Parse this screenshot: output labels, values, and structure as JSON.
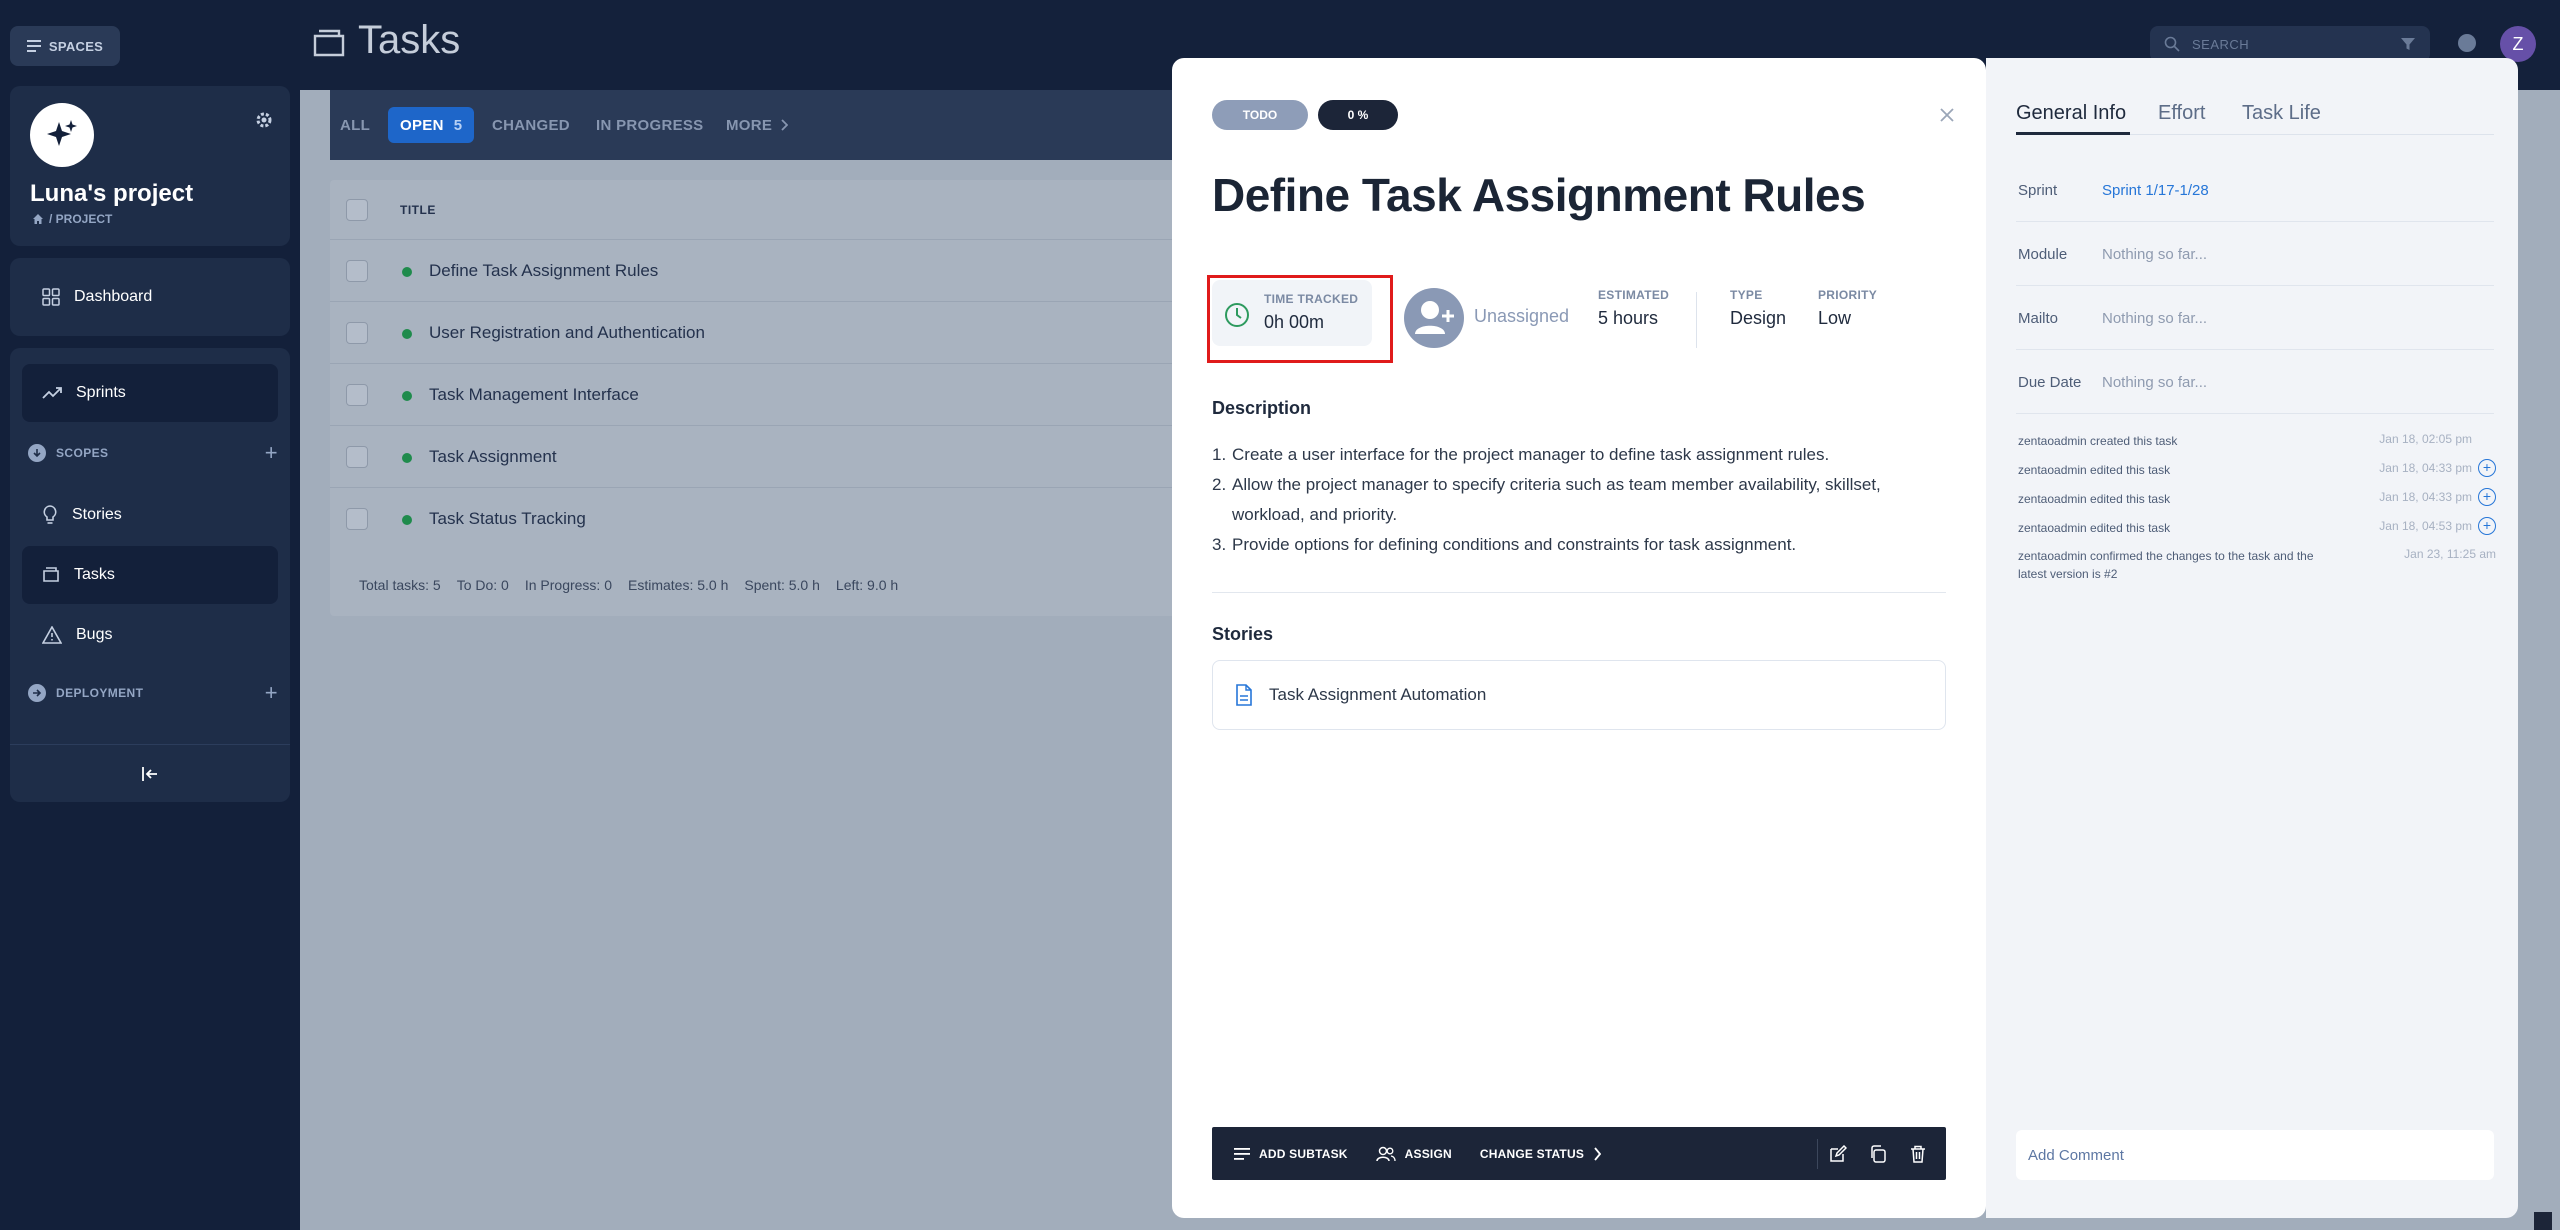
{
  "sidebar": {
    "spaces_label": "SPACES",
    "project_name": "Luna's project",
    "project_crumb": "/ PROJECT",
    "dashboard": "Dashboard",
    "sprints": "Sprints",
    "scopes": "SCOPES",
    "stories": "Stories",
    "tasks": "Tasks",
    "bugs": "Bugs",
    "deployment": "DEPLOYMENT"
  },
  "header": {
    "page_title": "Tasks",
    "search_placeholder": "SEARCH",
    "avatar_initial": "Z"
  },
  "filter_tabs": {
    "all": "ALL",
    "open": "OPEN",
    "open_count": "5",
    "changed": "CHANGED",
    "in_progress": "IN PROGRESS",
    "more": "MORE"
  },
  "task_list": {
    "column_title": "TITLE",
    "rows": [
      "Define Task Assignment Rules",
      "User Registration and Authentication",
      "Task Management Interface",
      "Task Assignment",
      "Task Status Tracking"
    ],
    "footer": {
      "total": "Total tasks: 5",
      "todo": "To Do: 0",
      "in_progress": "In Progress: 0",
      "estimates": "Estimates: 5.0 h",
      "spent": "Spent: 5.0 h",
      "left": "Left: 9.0 h"
    }
  },
  "task": {
    "status": "TODO",
    "progress": "0 %",
    "title": "Define Task Assignment Rules",
    "time_tracked_label": "TIME TRACKED",
    "time_tracked_value": "0h 00m",
    "assignee": "Unassigned",
    "estimated_label": "ESTIMATED",
    "estimated_value": "5 hours",
    "type_label": "TYPE",
    "type_value": "Design",
    "priority_label": "PRIORITY",
    "priority_value": "Low",
    "description_heading": "Description",
    "description": [
      "Create a user interface for the project manager to define task assignment rules.",
      "Allow the project manager to specify criteria such as team member availability, skillset, workload, and priority.",
      "Provide options for defining conditions and constraints for task assignment."
    ],
    "stories_heading": "Stories",
    "story": "Task Assignment Automation",
    "toolbar": {
      "add_subtask": "ADD SUBTASK",
      "assign": "ASSIGN",
      "change_status": "CHANGE STATUS"
    }
  },
  "info_panel": {
    "tabs": [
      "General Info",
      "Effort",
      "Task Life"
    ],
    "fields": [
      {
        "label": "Sprint",
        "value": "Sprint 1/17-1/28"
      },
      {
        "label": "Module",
        "value": "Nothing so far..."
      },
      {
        "label": "Mailto",
        "value": "Nothing so far..."
      },
      {
        "label": "Due Date",
        "value": "Nothing so far..."
      }
    ],
    "log": [
      {
        "text": "zentaoadmin created this task",
        "date": "Jan 18, 02:05 pm"
      },
      {
        "text": "zentaoadmin edited this task",
        "date": "Jan 18, 04:33 pm"
      },
      {
        "text": "zentaoadmin edited this task",
        "date": "Jan 18, 04:33 pm"
      },
      {
        "text": "zentaoadmin edited this task",
        "date": "Jan 18, 04:53 pm"
      },
      {
        "text": "zentaoadmin confirmed the changes to the task and the latest version is #2",
        "date": "Jan 23, 11:25 am"
      }
    ],
    "comment_placeholder": "Add Comment"
  },
  "colors": {
    "accent": "#1e66c9",
    "highlight": "#e01b1b",
    "status_dot": "#1f8b4c"
  }
}
